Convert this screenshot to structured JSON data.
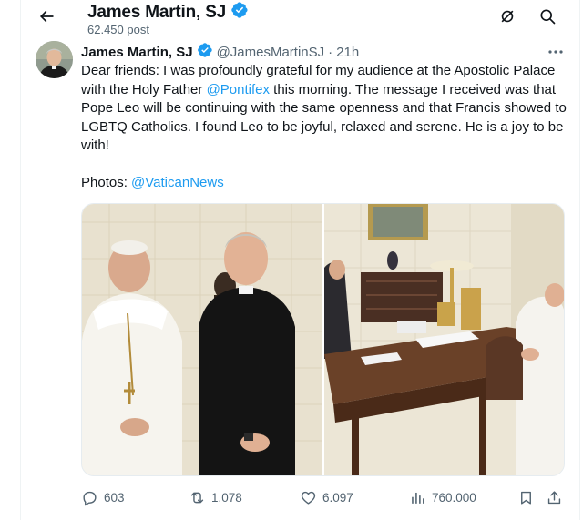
{
  "header": {
    "display_name": "James Martin, SJ",
    "post_count": "62.450 post",
    "back_icon": "arrow-left-icon",
    "grok_icon": "grok-icon",
    "search_icon": "search-icon"
  },
  "tweet": {
    "author_name": "James Martin, SJ",
    "handle": "@JamesMartinSJ",
    "separator": "·",
    "time": "21h",
    "text": {
      "part1": "Dear friends: I was profoundly grateful for my audience at the Apostolic Palace with the Holy Father ",
      "mention1": "@Pontifex",
      "part2": "  this morning. The message I received was that Pope Leo will be continuing with the same openness and that Francis showed to LGBTQ Catholics. I found Leo to be joyful, relaxed and serene.  He is a joy to be with!",
      "photos_label": "Photos: ",
      "mention2": "@VaticanNews"
    },
    "media": [
      {
        "alt": "photo-1",
        "description_icon": "photo"
      },
      {
        "alt": "photo-2",
        "description_icon": "photo"
      }
    ],
    "actions": {
      "replies": "603",
      "reposts": "1.078",
      "likes": "6.097",
      "views": "760.000"
    }
  },
  "colors": {
    "accent": "#1d9bf0",
    "text_primary": "#0f1419",
    "text_secondary": "#536471",
    "verified": "#1d9bf0"
  }
}
